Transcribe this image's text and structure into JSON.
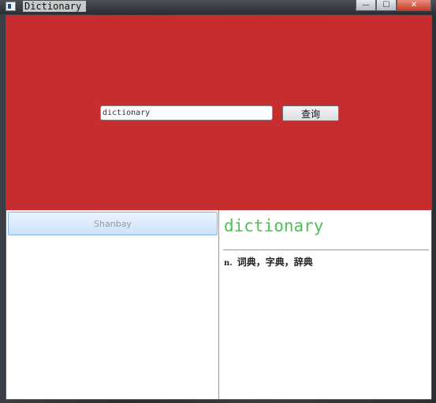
{
  "window": {
    "title": "Dictionary",
    "minimize_glyph": "—",
    "maximize_glyph": "☐",
    "close_glyph": "✕"
  },
  "search": {
    "value": "dictionary",
    "button_label": "查询"
  },
  "sources": {
    "items": [
      {
        "label": "Shanbay"
      }
    ]
  },
  "result": {
    "word": "dictionary",
    "pos": "n.",
    "meaning": "词典，字典，辞典"
  },
  "colors": {
    "hero_background": "#c62d2f",
    "word_color": "#4fc24f"
  }
}
